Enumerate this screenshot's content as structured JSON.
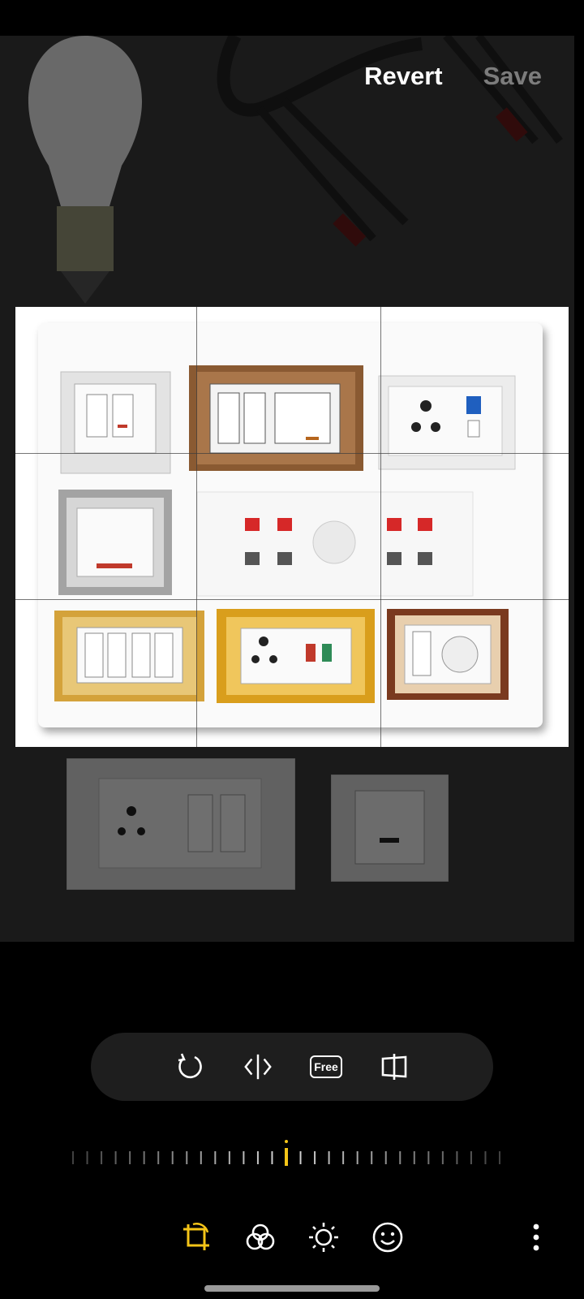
{
  "header": {
    "revert_label": "Revert",
    "save_label": "Save"
  },
  "toolbar": {
    "aspect_label": "Free"
  },
  "icons": {
    "rotate": "rotate-icon",
    "flip": "flip-icon",
    "aspect": "aspect-ratio-free-icon",
    "perspective": "perspective-icon",
    "crop": "crop-rotate-icon",
    "filters": "filters-icon",
    "brightness": "brightness-icon",
    "stickers": "sticker-emoji-icon",
    "more": "more-options-icon"
  },
  "colors": {
    "accent": "#f5c518",
    "inactive": "#7c7c7c",
    "toolbar_bg": "#1e1e1e"
  },
  "straighten_angle": 0
}
